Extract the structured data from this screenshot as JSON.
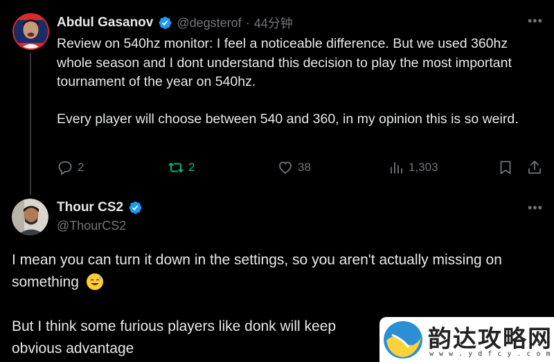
{
  "tweet1": {
    "author_name": "Abdul Gasanov",
    "handle": "@degsterof",
    "separator": "·",
    "time": "44分钟",
    "text_p1": "Review on 540hz monitor: I feel a noticeable difference. But we used 360hz whole season and I dont understand this decision to play the most important tournament of the year on 540hz.",
    "text_p2": "Every player will choose between 540 and 360, in my opinion this is so weird.",
    "replies": "2",
    "reposts": "2",
    "likes": "38",
    "views": "1,303"
  },
  "tweet2": {
    "author_name": "Thour CS2",
    "handle": "@ThourCS2",
    "text_p1": "I mean you can turn it down in the settings, so you aren't actually missing on something",
    "text_p2": "But I think some furious players like donk will keep",
    "text_p3": "obvious advantage"
  },
  "watermark": {
    "title": "韵达攻略网",
    "url": "w w w . y d f c y . c o m"
  },
  "colors": {
    "background": "#000000",
    "text": "#e7e9ea",
    "muted": "#71767b",
    "verified": "#1d9bf0",
    "repost_active": "#00ba7c"
  }
}
